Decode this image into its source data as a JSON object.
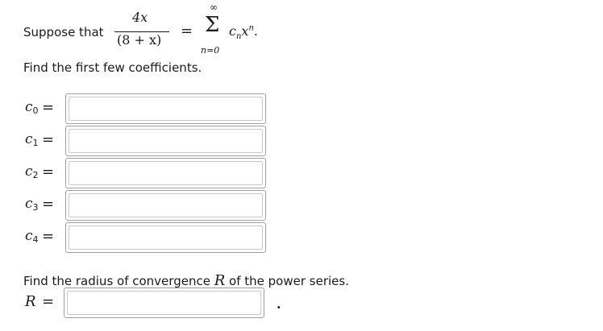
{
  "intro": {
    "prefix": "Suppose that",
    "numerator": "4x",
    "denominator": "(8 + x)",
    "equals": "=",
    "sum_symbol": "Σ",
    "sum_upper": "∞",
    "sum_lower": "n=0",
    "summand_c": "c",
    "summand_sub": "n",
    "summand_x": "x",
    "summand_sup": "n",
    "period": "."
  },
  "instruction": "Find the first few coefficients.",
  "coefficients": [
    {
      "var": "c",
      "sub": "0",
      "equals": "=",
      "value": ""
    },
    {
      "var": "c",
      "sub": "1",
      "equals": "=",
      "value": ""
    },
    {
      "var": "c",
      "sub": "2",
      "equals": "=",
      "value": ""
    },
    {
      "var": "c",
      "sub": "3",
      "equals": "=",
      "value": ""
    },
    {
      "var": "c",
      "sub": "4",
      "equals": "=",
      "value": ""
    }
  ],
  "radius_question": {
    "before": "Find the radius of convergence ",
    "symbol": "R",
    "after": " of the power series."
  },
  "radius_answer": {
    "label": "R",
    "equals": "=",
    "value": "",
    "trailing": "."
  }
}
